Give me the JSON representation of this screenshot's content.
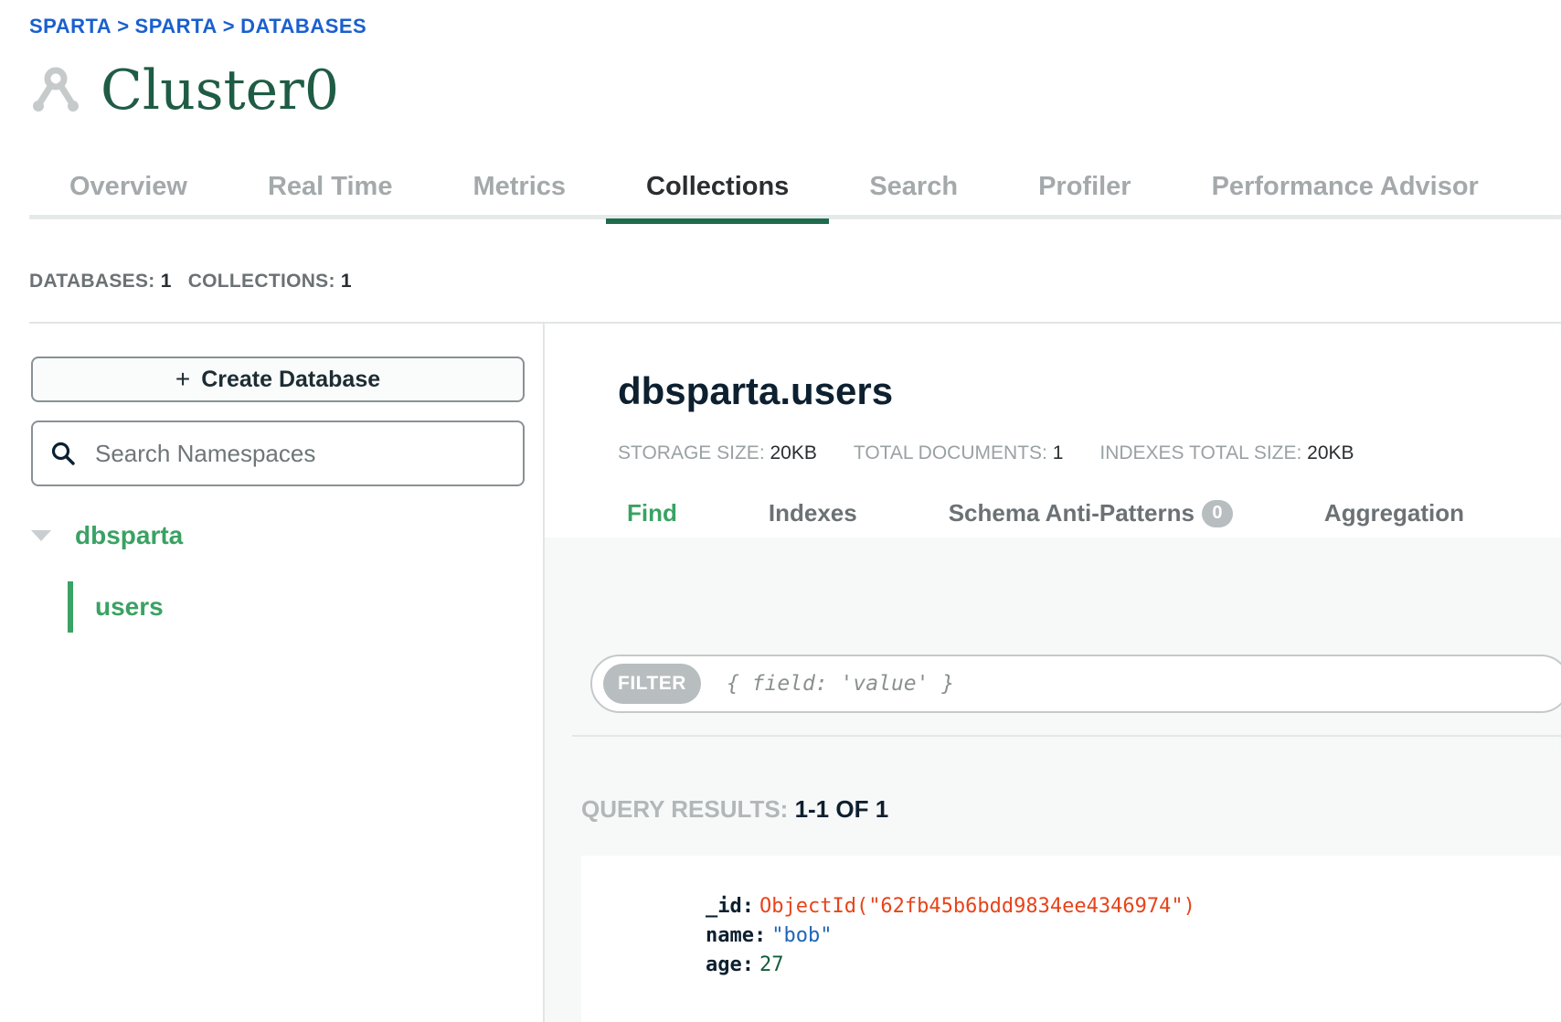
{
  "breadcrumb": [
    "SPARTA",
    "SPARTA",
    "DATABASES"
  ],
  "breadcrumb_separator": ">",
  "cluster": {
    "title": "Cluster0",
    "icon": "cluster-icon"
  },
  "top_tabs": [
    {
      "label": "Overview",
      "active": false
    },
    {
      "label": "Real Time",
      "active": false
    },
    {
      "label": "Metrics",
      "active": false
    },
    {
      "label": "Collections",
      "active": true
    },
    {
      "label": "Search",
      "active": false
    },
    {
      "label": "Profiler",
      "active": false
    },
    {
      "label": "Performance Advisor",
      "active": false
    }
  ],
  "counts": {
    "databases_label": "DATABASES:",
    "databases_value": "1",
    "collections_label": "COLLECTIONS:",
    "collections_value": "1"
  },
  "sidebar": {
    "create_button": {
      "icon": "+",
      "label": "Create Database"
    },
    "search": {
      "placeholder": "Search Namespaces",
      "value": "",
      "icon": "search-icon"
    },
    "databases": [
      {
        "name": "dbsparta",
        "expanded": true,
        "collections": [
          {
            "name": "users",
            "selected": true
          }
        ]
      }
    ]
  },
  "main": {
    "namespace": "dbsparta.users",
    "stats": [
      {
        "label": "STORAGE SIZE:",
        "value": "20KB"
      },
      {
        "label": "TOTAL DOCUMENTS:",
        "value": "1"
      },
      {
        "label": "INDEXES TOTAL SIZE:",
        "value": "20KB"
      }
    ],
    "sub_tabs": [
      {
        "label": "Find",
        "active": true
      },
      {
        "label": "Indexes",
        "active": false
      },
      {
        "label": "Schema Anti-Patterns",
        "active": false,
        "badge": "0"
      },
      {
        "label": "Aggregation",
        "active": false
      }
    ],
    "filter": {
      "label": "FILTER",
      "placeholder": "{ field: 'value' }",
      "value": ""
    },
    "results": {
      "label": "QUERY RESULTS:",
      "value": "1-1 OF 1"
    },
    "document": [
      {
        "key": "_id:",
        "value": "ObjectId(\"62fb45b6bdd9834ee4346974\")",
        "type": "oid"
      },
      {
        "key": "name:",
        "value": "\"bob\"",
        "type": "str"
      },
      {
        "key": "age:",
        "value": "27",
        "type": "num"
      }
    ]
  },
  "colors": {
    "accent_green": "#3aa263",
    "title_green": "#1f5c45",
    "breadcrumb_blue": "#1a5fcf",
    "objectid_red": "#e8431a",
    "string_blue": "#1f64b8",
    "active_tab_underline": "#1f6b4e"
  }
}
